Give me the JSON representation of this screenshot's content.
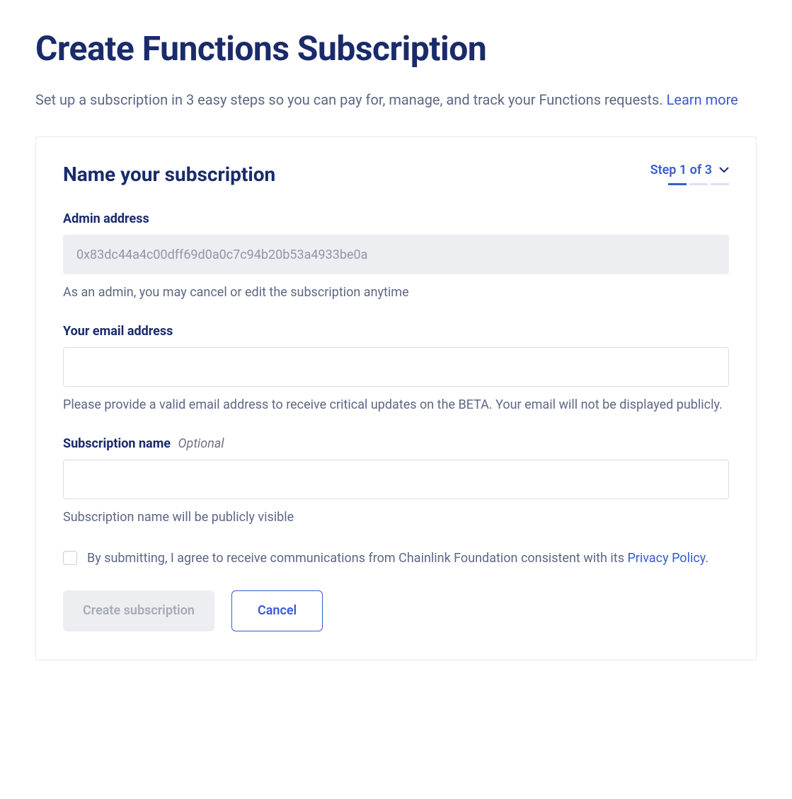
{
  "page": {
    "title": "Create Functions Subscription",
    "subtitle_prefix": "Set up a subscription in 3 easy steps so you can pay for, manage, and track your Functions requests. ",
    "learn_more": "Learn more"
  },
  "card": {
    "section_title": "Name your subscription",
    "step_text": "Step 1 of 3",
    "step_current": 1,
    "step_total": 3
  },
  "fields": {
    "admin": {
      "label": "Admin address",
      "value": "0x83dc44a4c00dff69d0a0c7c94b20b53a4933be0a",
      "helper": "As an admin, you may cancel or edit the subscription anytime"
    },
    "email": {
      "label": "Your email address",
      "value": "",
      "helper": "Please provide a valid email address to receive critical updates on the BETA. Your email will not be displayed publicly."
    },
    "subname": {
      "label": "Subscription name",
      "optional": "Optional",
      "value": "",
      "helper": "Subscription name will be publicly visible"
    }
  },
  "consent": {
    "text_prefix": "By submitting, I agree to receive communications from Chainlink Foundation consistent with its ",
    "link_text": "Privacy Policy",
    "text_suffix": "."
  },
  "buttons": {
    "create": "Create subscription",
    "cancel": "Cancel"
  }
}
